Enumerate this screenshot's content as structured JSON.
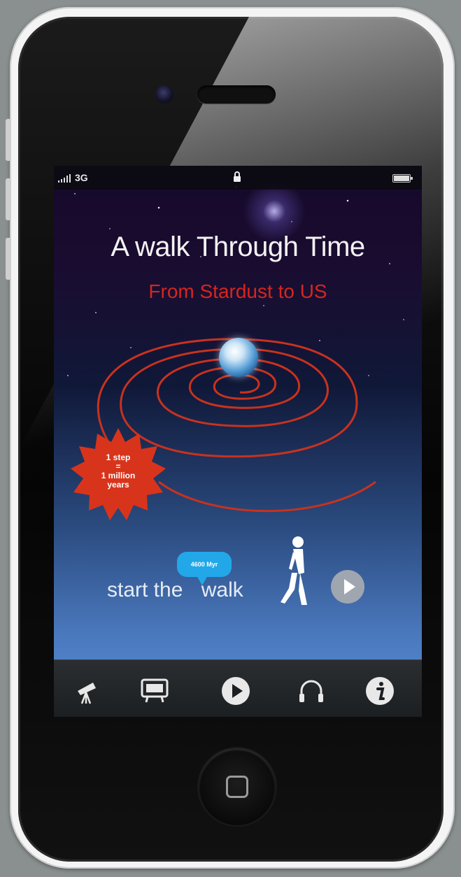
{
  "status_bar": {
    "carrier": "3G",
    "signal_icon": "signal-bars-icon",
    "lock_icon": "lock-icon",
    "battery_icon": "battery-icon"
  },
  "app": {
    "title": "A walk Through Time",
    "subtitle": "From Stardust to US",
    "badge_line1": "1 step",
    "badge_line2": "=",
    "badge_line3": "1 million",
    "badge_line4": "years",
    "start_text_1": "start the",
    "start_text_2": "walk",
    "bubble_label": "4600 Myr"
  },
  "tabbar": {
    "items": [
      {
        "icon": "telescope-icon"
      },
      {
        "icon": "sign-board-icon"
      },
      {
        "icon": "play-icon"
      },
      {
        "icon": "headphones-icon"
      },
      {
        "icon": "info-icon"
      }
    ]
  },
  "colors": {
    "title": "#f2f2f2",
    "subtitle": "#d7251e",
    "orbit": "#c8321e",
    "bubble": "#22a8e8"
  }
}
